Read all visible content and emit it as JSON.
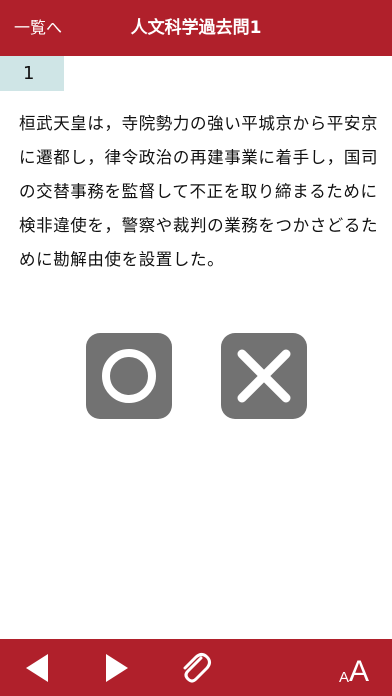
{
  "header": {
    "back_label": "一覧へ",
    "title": "人文科学過去問1",
    "bg_color": "#b0202b"
  },
  "question": {
    "number": "1",
    "text": "桓武天皇は，寺院勢力の強い平城京から平安京に遷都し，律令政治の再建事業に着手し，国司の交替事務を監督して不正を取り締まるために検非違使を，警察や裁判の業務をつかさどるために勘解由使を設置した。"
  },
  "answers": {
    "true_icon": "circle-icon",
    "false_icon": "cross-icon",
    "button_color": "#727272"
  },
  "footer": {
    "prev_icon": "triangle-left-icon",
    "next_icon": "triangle-right-icon",
    "attach_icon": "paperclip-icon",
    "font_small": "A",
    "font_large": "A"
  }
}
